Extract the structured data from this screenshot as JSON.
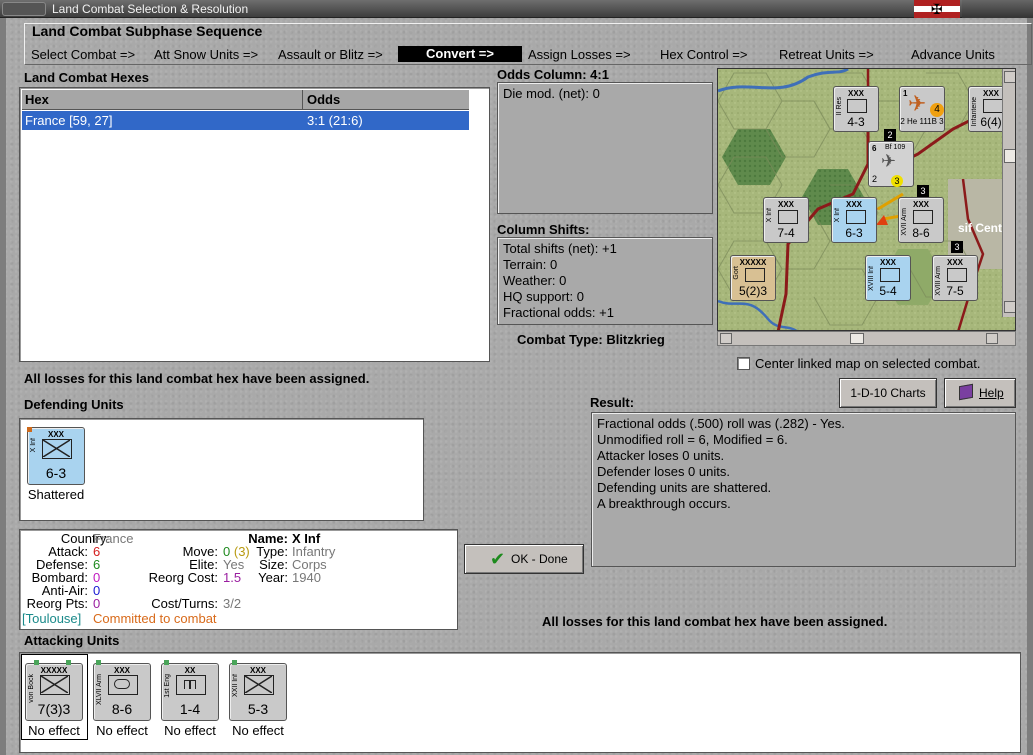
{
  "window": {
    "title": "Land Combat Selection & Resolution"
  },
  "sequence": {
    "title": "Land Combat Subphase Sequence",
    "steps": [
      "Select Combat =>",
      "Att Snow Units =>",
      "Assault or Blitz =>",
      "Convert =>",
      "Assign Losses =>",
      "Hex Control =>",
      "Retreat Units =>",
      "Advance Units"
    ],
    "active_index": 3
  },
  "hexes": {
    "title": "Land Combat Hexes",
    "columns": [
      "Hex",
      "Odds"
    ],
    "rows": [
      {
        "hex": "France [59, 27]",
        "odds": "3:1 (21:6)"
      }
    ]
  },
  "odds": {
    "title": "Odds Column: 4:1",
    "die_mod": "Die mod. (net): 0"
  },
  "shifts": {
    "title": "Column Shifts:",
    "lines": [
      "Total shifts (net): +1",
      "Terrain: 0",
      "Weather: 0",
      "HQ support: 0",
      "Fractional odds: +1"
    ]
  },
  "combat_type": "Combat Type:  Blitzkrieg",
  "map": {
    "checkbox_label": "Center linked map on selected combat.",
    "checked": false,
    "terrain_text": "sif Centr",
    "hex_badges": [
      "2",
      "3",
      "3"
    ],
    "counters": [
      {
        "echelon": "XXX",
        "name": "II Res",
        "strength": "4-3"
      },
      {
        "echelon": "",
        "name": "He 111B",
        "strength": "2 He 111B 3"
      },
      {
        "echelon": "XXX",
        "name": "Infanterie",
        "strength": "6(4)"
      },
      {
        "echelon": "",
        "name": "Bf 109",
        "strength": "2"
      },
      {
        "echelon": "XXX",
        "name": "X Inf",
        "strength": "7-4"
      },
      {
        "echelon": "XXX",
        "name": "X Inf",
        "strength": "6-3"
      },
      {
        "echelon": "XXX",
        "name": "XVII Arm",
        "strength": "8-6"
      },
      {
        "echelon": "XXXXX",
        "name": "Gort",
        "strength": "5(2)3"
      },
      {
        "echelon": "XXX",
        "name": "XVIII Inf",
        "strength": "5-4"
      },
      {
        "echelon": "XXX",
        "name": "XVIII Arm",
        "strength": "7-5"
      }
    ],
    "bf109_top": "6",
    "bf109_mid": "Bf 109",
    "bf109_bot": "2",
    "bf109_badge": "3",
    "he111_badge": "4",
    "he111_top": "1"
  },
  "buttons": {
    "charts": "1-D-10 Charts",
    "help": "Help",
    "ok": "OK - Done"
  },
  "losses_note_top": "All losses for this land combat hex have been assigned.",
  "losses_note_bottom": "All losses for this land combat hex have been assigned.",
  "defending": {
    "title": "Defending Units",
    "units": [
      {
        "echelon": "XXX",
        "name": "X Inf",
        "strength": "6-3",
        "caption": "Shattered"
      }
    ]
  },
  "unit_info": {
    "country_label": "Country:",
    "country": "France",
    "attack_label": "Attack:",
    "attack": "6",
    "defense_label": "Defense:",
    "defense": "6",
    "bombard_label": "Bombard:",
    "bombard": "0",
    "antiair_label": "Anti-Air:",
    "antiair": "0",
    "reorgpts_label": "Reorg Pts:",
    "reorgpts": "0",
    "name_label": "Name:",
    "name": "X Inf",
    "type_label": "Type:",
    "type": "Infantry",
    "size_label": "Size:",
    "size": "Corps",
    "year_label": "Year:",
    "year": "1940",
    "move_label": "Move:",
    "move": "0",
    "move_extra": "(3)",
    "elite_label": "Elite:",
    "elite": "Yes",
    "reorgcost_label": "Reorg Cost:",
    "reorgcost": "1.5",
    "costturns_label": "Cost/Turns:",
    "costturns": "3/2",
    "location": "[Toulouse]",
    "status": "Committed to combat"
  },
  "result": {
    "title": "Result:",
    "lines": [
      "Fractional odds (.500) roll was (.282)  - Yes.",
      "Unmodified roll = 6, Modified = 6.",
      "Attacker loses 0 units.",
      "Defender loses 0 units.",
      "Defending units are shattered.",
      "A breakthrough occurs."
    ]
  },
  "attacking": {
    "title": "Attacking Units",
    "units": [
      {
        "echelon": "XXXXX",
        "name": "von Bock",
        "strength": "7(3)3",
        "caption": "No effect"
      },
      {
        "echelon": "XXX",
        "name": "XLVII Arm",
        "strength": "8-6",
        "caption": "No effect"
      },
      {
        "echelon": "XX",
        "name": "1st Eng",
        "strength": "1-4",
        "caption": "No effect"
      },
      {
        "echelon": "XXX",
        "name": "XXII Inf",
        "strength": "5-3",
        "caption": "No effect"
      }
    ]
  },
  "colors": {
    "french_unit": "#a9d3ef",
    "german_unit": "#c9c9c9",
    "commander_unit": "#d8c093",
    "selection": "#3168c8",
    "attack_red": "#d42020",
    "defense_green": "#1f8a1f",
    "bombard_magenta": "#c018c0",
    "antiair_blue": "#1a1ad4",
    "reorg_purple": "#9a1ea0",
    "status_orange": "#d86a1a",
    "location_teal": "#1a8a8a"
  }
}
